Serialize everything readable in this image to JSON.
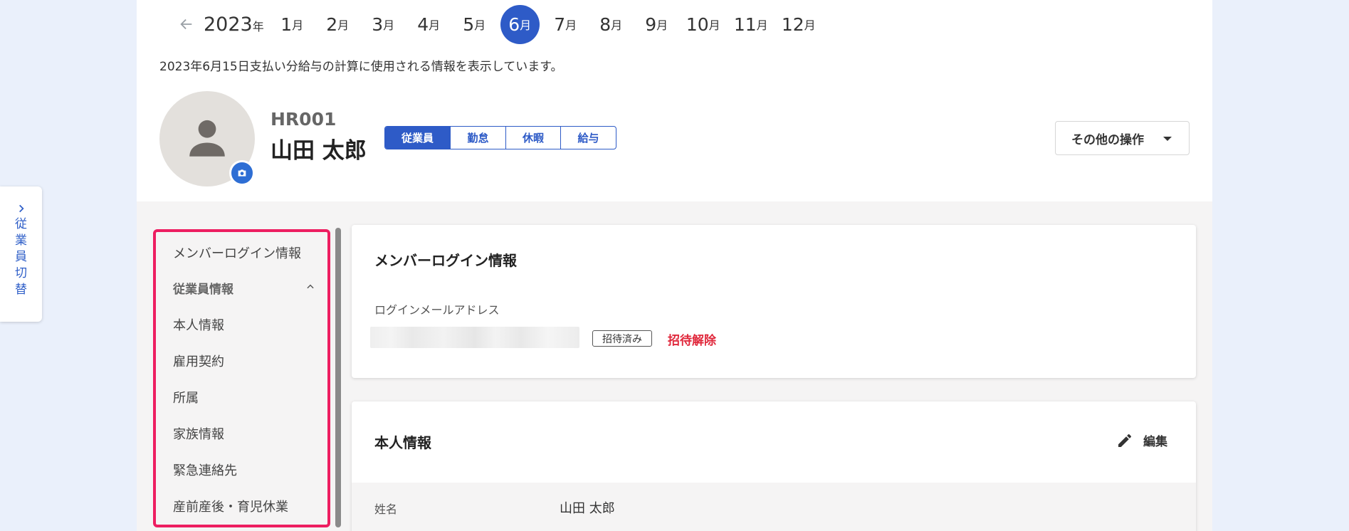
{
  "switcher": {
    "label_chars": [
      "従",
      "業",
      "員",
      "切",
      "替"
    ]
  },
  "monthbar": {
    "year_num": "2023",
    "year_unit": "年",
    "months": [
      {
        "num": "1",
        "unit": "月"
      },
      {
        "num": "2",
        "unit": "月"
      },
      {
        "num": "3",
        "unit": "月"
      },
      {
        "num": "4",
        "unit": "月"
      },
      {
        "num": "5",
        "unit": "月"
      },
      {
        "num": "6",
        "unit": "月"
      },
      {
        "num": "7",
        "unit": "月"
      },
      {
        "num": "8",
        "unit": "月"
      },
      {
        "num": "9",
        "unit": "月"
      },
      {
        "num": "10",
        "unit": "月"
      },
      {
        "num": "11",
        "unit": "月"
      },
      {
        "num": "12",
        "unit": "月"
      }
    ],
    "selected_month": "6"
  },
  "info_text": "2023年6月15日支払い分給与の計算に使用される情報を表示しています。",
  "profile": {
    "code": "HR001",
    "name": "山田 太郎",
    "tabs": [
      "従業員",
      "勤怠",
      "休暇",
      "給与"
    ],
    "active_tab": "従業員"
  },
  "other_actions": {
    "label": "その他の操作"
  },
  "sidenav": {
    "items": [
      {
        "label": "メンバーログイン情報"
      },
      {
        "label": "従業員情報",
        "section": true
      },
      {
        "label": "本人情報"
      },
      {
        "label": "雇用契約"
      },
      {
        "label": "所属"
      },
      {
        "label": "家族情報"
      },
      {
        "label": "緊急連絡先"
      },
      {
        "label": "産前産後・育児休業"
      }
    ]
  },
  "login_card": {
    "title": "メンバーログイン情報",
    "email_label": "ログインメールアドレス",
    "status_tag": "招待済み",
    "revoke_label": "招待解除"
  },
  "personal_card": {
    "title": "本人情報",
    "edit_label": "編集",
    "name_label": "姓名",
    "name_value": "山田 太郎"
  },
  "colors": {
    "accent": "#2e5bc7",
    "highlight_border": "#ed1e61",
    "danger": "#e0283c"
  }
}
